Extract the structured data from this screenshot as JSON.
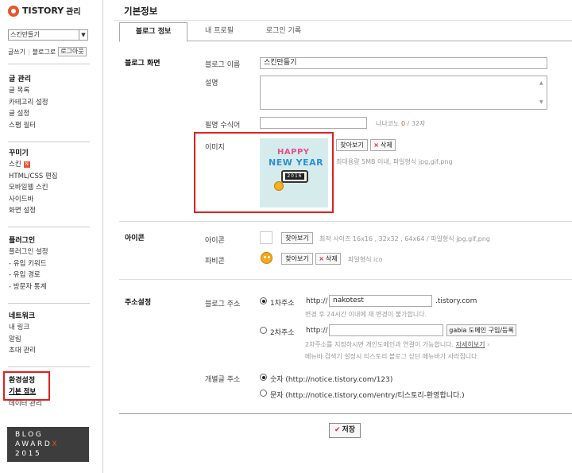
{
  "sidebar": {
    "brand": "TISTORY",
    "brand_suffix": "관리",
    "blog_select": "스킨만들기",
    "links": {
      "write": "글쓰기",
      "blog": "블로그로",
      "logout": "로그아웃"
    },
    "groups": [
      {
        "title": "글 관리",
        "items": [
          "글 목록",
          "카테고리 설정",
          "글 설정",
          "스팸 필터"
        ]
      },
      {
        "title": "꾸미기",
        "items": [
          "스킨",
          "HTML/CSS 편집",
          "모바일웹 스킨",
          "사이드바",
          "화면 설정"
        ]
      },
      {
        "title": "플러그인",
        "items": [
          "플러그인 설정",
          "- 유입 키워드",
          "- 유입 경로",
          "- 방문자 통계"
        ]
      },
      {
        "title": "네트워크",
        "items": [
          "내 링크",
          "알림",
          "초대 관리"
        ]
      },
      {
        "title": "환경설정",
        "items": [
          "기본 정보",
          "데이터 관리"
        ]
      }
    ],
    "new_badge": "N",
    "award": {
      "line1": "BLOG",
      "line2": "AWARD",
      "line2_x": "X",
      "line3": "2015"
    }
  },
  "main": {
    "title": "기본정보",
    "tabs": [
      {
        "label": "블로그 정보",
        "active": true
      },
      {
        "label": "내 프로필",
        "active": false
      },
      {
        "label": "로그인 기록",
        "active": false
      }
    ],
    "blog_screen": {
      "section": "블로그 화면",
      "name_label": "블로그 이름",
      "name_value": "스킨만들기",
      "desc_label": "설명",
      "desc_value": "",
      "nick_label": "필명 수식어",
      "nick_value": "",
      "nick_hint": "나나코노",
      "nick_count": "0",
      "nick_max": " / 32자",
      "image_label": "이미지",
      "find_btn": "찾아보기",
      "delete_btn": "삭제",
      "image_hint": "최대용량 5MB 이내, 파일형식 jpg,gif,png",
      "image_text": {
        "happy": "HAPPY",
        "newyear": "NEW YEAR",
        "year": "2016"
      }
    },
    "icon_section": {
      "section": "아이콘",
      "icon_label": "아이콘",
      "icon_find": "찾아보기",
      "icon_hint": "최적 사이즈 16x16 , 32x32 , 64x64 / 파일형식 jpg,gif,png",
      "fav_label": "파비콘",
      "fav_find": "찾아보기",
      "fav_delete": "삭제",
      "fav_hint": "파일형식 ico"
    },
    "address": {
      "section": "주소설정",
      "blog_addr_label": "블로그 주소",
      "primary_label": "1차주소",
      "http": "http://",
      "primary_value": "nakotest",
      "primary_domain": ".tistory.com",
      "primary_hint": "변경 후 24시간 이내에 재 변경이 불가합니다.",
      "secondary_label": "2차주소",
      "secondary_value": "",
      "gabia_btn": "gabia 도메인 구입/등록",
      "secondary_hint1": "2차주소를 지정하시면 개인도메인과 연결이 가능합니다.",
      "secondary_hint_link": "자세히보기",
      "secondary_hint2": "메뉴바 검색기 설정시 티스토리 블로그 상단 메뉴바가 사라집니다.",
      "post_addr_label": "개별글 주소",
      "opt_number": "숫자 (http://notice.tistory.com/123)",
      "opt_text": "문자 (http://notice.tistory.com/entry/티스토리-환영합니다.)"
    },
    "save_btn": "저장"
  },
  "colors": {
    "accent": "#e8542d",
    "highlight_box": "#e02020"
  }
}
